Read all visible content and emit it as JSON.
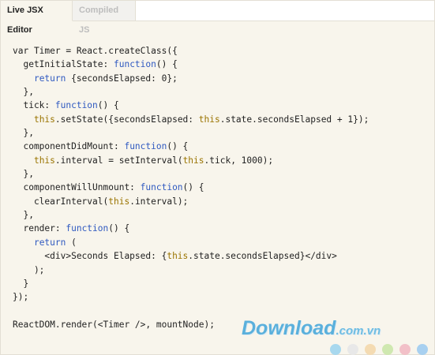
{
  "tabs": [
    {
      "label": "Live JSX Editor",
      "active": true
    },
    {
      "label": "Compiled JS",
      "active": false
    }
  ],
  "code_lines": [
    [
      {
        "t": "var Timer = React.createClass({",
        "c": "plain"
      }
    ],
    [
      {
        "t": "  getInitialState: ",
        "c": "plain"
      },
      {
        "t": "function",
        "c": "kw"
      },
      {
        "t": "() {",
        "c": "plain"
      }
    ],
    [
      {
        "t": "    ",
        "c": "plain"
      },
      {
        "t": "return",
        "c": "kw"
      },
      {
        "t": " {secondsElapsed: 0};",
        "c": "plain"
      }
    ],
    [
      {
        "t": "  },",
        "c": "plain"
      }
    ],
    [
      {
        "t": "  tick: ",
        "c": "plain"
      },
      {
        "t": "function",
        "c": "kw"
      },
      {
        "t": "() {",
        "c": "plain"
      }
    ],
    [
      {
        "t": "    ",
        "c": "plain"
      },
      {
        "t": "this",
        "c": "this"
      },
      {
        "t": ".setState({secondsElapsed: ",
        "c": "plain"
      },
      {
        "t": "this",
        "c": "this"
      },
      {
        "t": ".state.secondsElapsed + 1});",
        "c": "plain"
      }
    ],
    [
      {
        "t": "  },",
        "c": "plain"
      }
    ],
    [
      {
        "t": "  componentDidMount: ",
        "c": "plain"
      },
      {
        "t": "function",
        "c": "kw"
      },
      {
        "t": "() {",
        "c": "plain"
      }
    ],
    [
      {
        "t": "    ",
        "c": "plain"
      },
      {
        "t": "this",
        "c": "this"
      },
      {
        "t": ".interval = setInterval(",
        "c": "plain"
      },
      {
        "t": "this",
        "c": "this"
      },
      {
        "t": ".tick, 1000);",
        "c": "plain"
      }
    ],
    [
      {
        "t": "  },",
        "c": "plain"
      }
    ],
    [
      {
        "t": "  componentWillUnmount: ",
        "c": "plain"
      },
      {
        "t": "function",
        "c": "kw"
      },
      {
        "t": "() {",
        "c": "plain"
      }
    ],
    [
      {
        "t": "    clearInterval(",
        "c": "plain"
      },
      {
        "t": "this",
        "c": "this"
      },
      {
        "t": ".interval);",
        "c": "plain"
      }
    ],
    [
      {
        "t": "  },",
        "c": "plain"
      }
    ],
    [
      {
        "t": "  render: ",
        "c": "plain"
      },
      {
        "t": "function",
        "c": "kw"
      },
      {
        "t": "() {",
        "c": "plain"
      }
    ],
    [
      {
        "t": "    ",
        "c": "plain"
      },
      {
        "t": "return",
        "c": "kw"
      },
      {
        "t": " (",
        "c": "plain"
      }
    ],
    [
      {
        "t": "      <div>Seconds Elapsed: {",
        "c": "plain"
      },
      {
        "t": "this",
        "c": "this"
      },
      {
        "t": ".state.secondsElapsed}</div>",
        "c": "plain"
      }
    ],
    [
      {
        "t": "    );",
        "c": "plain"
      }
    ],
    [
      {
        "t": "  }",
        "c": "plain"
      }
    ],
    [
      {
        "t": "});",
        "c": "plain"
      }
    ],
    [
      {
        "t": "",
        "c": "plain"
      }
    ],
    [
      {
        "t": "ReactDOM.render(<Timer />, mountNode);",
        "c": "plain"
      }
    ]
  ],
  "watermark": {
    "main": "Download",
    "suffix": ".com.vn"
  },
  "dot_colors": [
    "#a8d8ee",
    "#e8e8e8",
    "#f4dbb2",
    "#cfe8b0",
    "#f2c0c8",
    "#a8d0f0"
  ]
}
